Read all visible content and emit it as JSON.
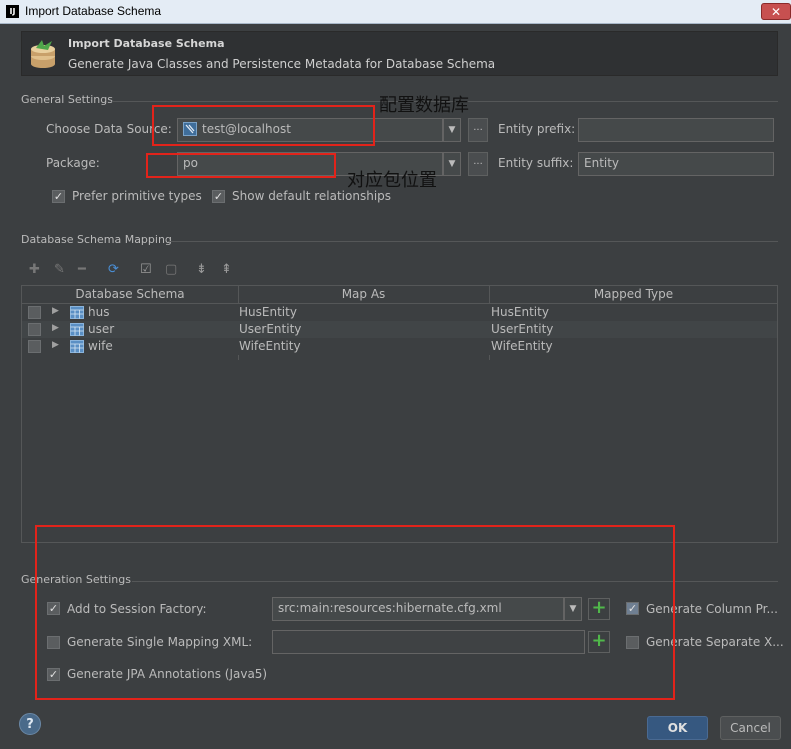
{
  "window": {
    "app_icon": "IJ",
    "title": "Import Database Schema",
    "close": "✕"
  },
  "header": {
    "title": "Import Database Schema",
    "subtitle": "Generate Java Classes and Persistence Metadata for Database Schema",
    "icon": "database-stack-icon"
  },
  "general": {
    "section": "General Settings",
    "data_source_label": "Choose Data Source:",
    "data_source_value": "test@localhost",
    "package_label": "Package:",
    "package_value": "po",
    "entity_prefix_label": "Entity prefix:",
    "entity_prefix_value": "",
    "entity_suffix_label": "Entity suffix:",
    "entity_suffix_value": "Entity",
    "ellipsis": "...",
    "prefer_primitive": "Prefer primitive types",
    "show_default_rel": "Show default relationships"
  },
  "annotations": {
    "data_source_note": "配置数据库",
    "package_note": "对应包位置",
    "color": "#e2231a"
  },
  "mapping": {
    "section": "Database Schema Mapping",
    "columns": [
      "Database Schema",
      "Map As",
      "Mapped Type"
    ],
    "rows": [
      {
        "schema": "hus",
        "map_as": "HusEntity",
        "mapped_type": "HusEntity"
      },
      {
        "schema": "user",
        "map_as": "UserEntity",
        "mapped_type": "UserEntity"
      },
      {
        "schema": "wife",
        "map_as": "WifeEntity",
        "mapped_type": "WifeEntity"
      }
    ]
  },
  "generation": {
    "section": "Generation Settings",
    "add_session_factory": "Add to Session Factory:",
    "session_factory_value": "src:main:resources:hibernate.cfg.xml",
    "single_mapping_xml": "Generate Single Mapping XML:",
    "single_mapping_value": "",
    "jpa_annotations": "Generate JPA Annotations (Java5)",
    "gen_column_props": "Generate Column Pr...",
    "gen_separate_x": "Generate Separate X..."
  },
  "footer": {
    "help": "?",
    "ok": "OK",
    "cancel": "Cancel"
  },
  "colors": {
    "background": "#3c3f41",
    "accent": "#365880",
    "annotation": "#e2231a"
  }
}
